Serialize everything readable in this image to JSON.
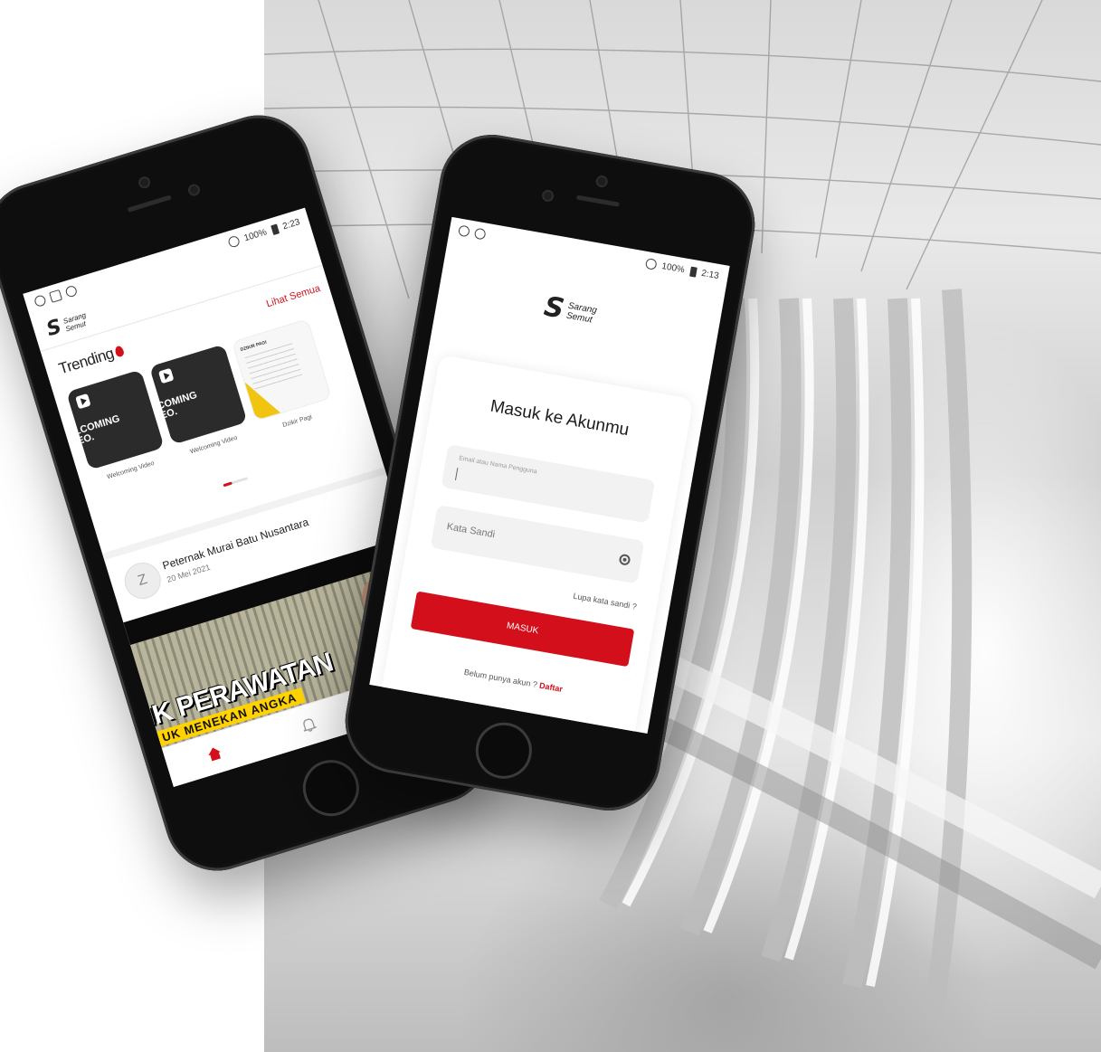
{
  "left_phone": {
    "status": {
      "left_icons": [
        "record-icon",
        "monitor-icon",
        "usb-icon"
      ],
      "battery": "100%",
      "time": "2:23"
    },
    "logo": {
      "line1": "Sarang",
      "line2": "Semut"
    },
    "trending": {
      "title": "Trending",
      "see_all": "Lihat Semua",
      "cards": [
        {
          "label": "Welcoming Video",
          "overlay": "LCOMING\nEO."
        },
        {
          "label": "Welcoming Video",
          "overlay": "COMING\nEO."
        },
        {
          "label": "Dzikir Pagi",
          "overlay": "DZIKIR PAGI"
        }
      ]
    },
    "post": {
      "avatar": "Z",
      "author": "Peternak Murai Batu Nusantara",
      "date": "20 Mei 2021",
      "video_title": "IK PERAWATAN",
      "video_subtitle": "UK MENEKAN ANGKA"
    },
    "bottom_nav": [
      "home-icon",
      "bell-icon",
      "search-icon"
    ],
    "accent": "#d40f1c"
  },
  "right_phone": {
    "status": {
      "battery": "100%",
      "time": "2:13"
    },
    "logo": {
      "line1": "Sarang",
      "line2": "Semut"
    },
    "login": {
      "title": "Masuk ke Akunmu",
      "email_placeholder": "Email atau Nama Pengguna",
      "password_placeholder": "Kata Sandi",
      "forgot": "Lupa kata sandi ?",
      "submit": "MASUK",
      "signup_prompt": "Belum punya akun ?",
      "signup_link": "Daftar"
    },
    "accent": "#d40f1c"
  }
}
